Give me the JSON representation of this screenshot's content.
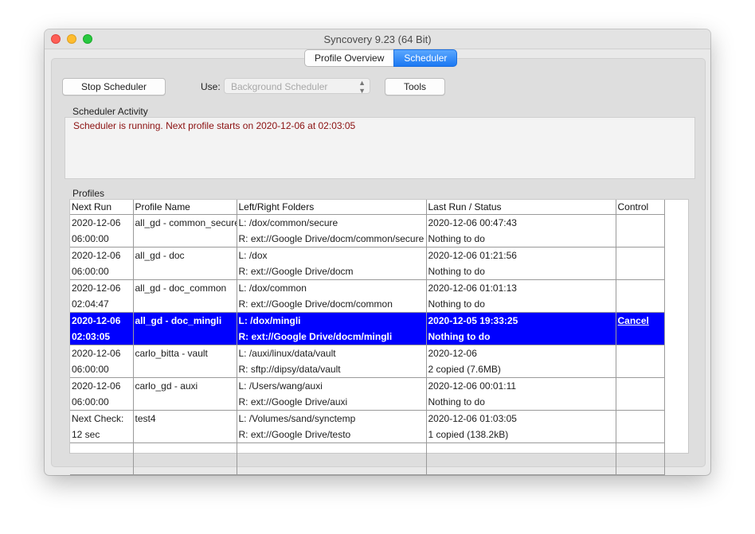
{
  "window": {
    "title": "Syncovery 9.23 (64 Bit)",
    "traffic_lights": [
      "close-button",
      "minimize-button",
      "zoom-button"
    ]
  },
  "tabs": [
    {
      "label": "Profile Overview",
      "active": false
    },
    {
      "label": "Scheduler",
      "active": true
    }
  ],
  "toolbar": {
    "stop_label": "Stop Scheduler",
    "use_label": "Use:",
    "use_value": "Background Scheduler",
    "tools_label": "Tools"
  },
  "activity": {
    "heading": "Scheduler Activity",
    "message": "Scheduler is running. Next profile starts on 2020-12-06 at 02:03:05",
    "message_color": "#8b1010"
  },
  "profiles": {
    "heading": "Profiles",
    "columns": [
      "Next Run",
      "Profile Name",
      "Left/Right Folders",
      "Last Run / Status",
      "Control"
    ],
    "selected_color": "#0000ff",
    "rows": [
      {
        "next1": "2020-12-06",
        "next2": "06:00:00",
        "name": "all_gd - common_secure",
        "left": "L: /dox/common/secure",
        "right": "R: ext://Google Drive/docm/common/secure",
        "last1": "2020-12-06 00:47:43",
        "last2": "Nothing to do",
        "control": "",
        "selected": false
      },
      {
        "next1": "2020-12-06",
        "next2": "06:00:00",
        "name": "all_gd - doc",
        "left": "L: /dox",
        "right": "R: ext://Google Drive/docm",
        "last1": "2020-12-06 01:21:56",
        "last2": "Nothing to do",
        "control": "",
        "selected": false
      },
      {
        "next1": "2020-12-06",
        "next2": "02:04:47",
        "name": "all_gd - doc_common",
        "left": "L: /dox/common",
        "right": "R: ext://Google Drive/docm/common",
        "last1": "2020-12-06 01:01:13",
        "last2": "Nothing to do",
        "control": "",
        "selected": false
      },
      {
        "next1": "2020-12-06",
        "next2": "02:03:05",
        "name": "all_gd - doc_mingli",
        "left": "L: /dox/mingli",
        "right": "R: ext://Google Drive/docm/mingli",
        "last1": "2020-12-05 19:33:25",
        "last2": "Nothing to do",
        "control": "Cancel",
        "selected": true
      },
      {
        "next1": "2020-12-06",
        "next2": "06:00:00",
        "name": "carlo_bitta - vault",
        "left": "L: /auxi/linux/data/vault",
        "right": "R: sftp://dipsy/data/vault",
        "last1": "2020-12-06",
        "last2": "2 copied (7.6MB)",
        "control": "",
        "selected": false
      },
      {
        "next1": "2020-12-06",
        "next2": "06:00:00",
        "name": "carlo_gd - auxi",
        "left": "L: /Users/wang/auxi",
        "right": "R: ext://Google Drive/auxi",
        "last1": "2020-12-06 00:01:11",
        "last2": "Nothing to do",
        "control": "",
        "selected": false
      },
      {
        "next1": "Next Check:",
        "next2": "12 sec",
        "name": "test4",
        "left": "L: /Volumes/sand/synctemp",
        "right": "R: ext://Google Drive/testo",
        "last1": "2020-12-06 01:03:05",
        "last2": "1 copied (138.2kB)",
        "control": "",
        "selected": false
      }
    ]
  }
}
